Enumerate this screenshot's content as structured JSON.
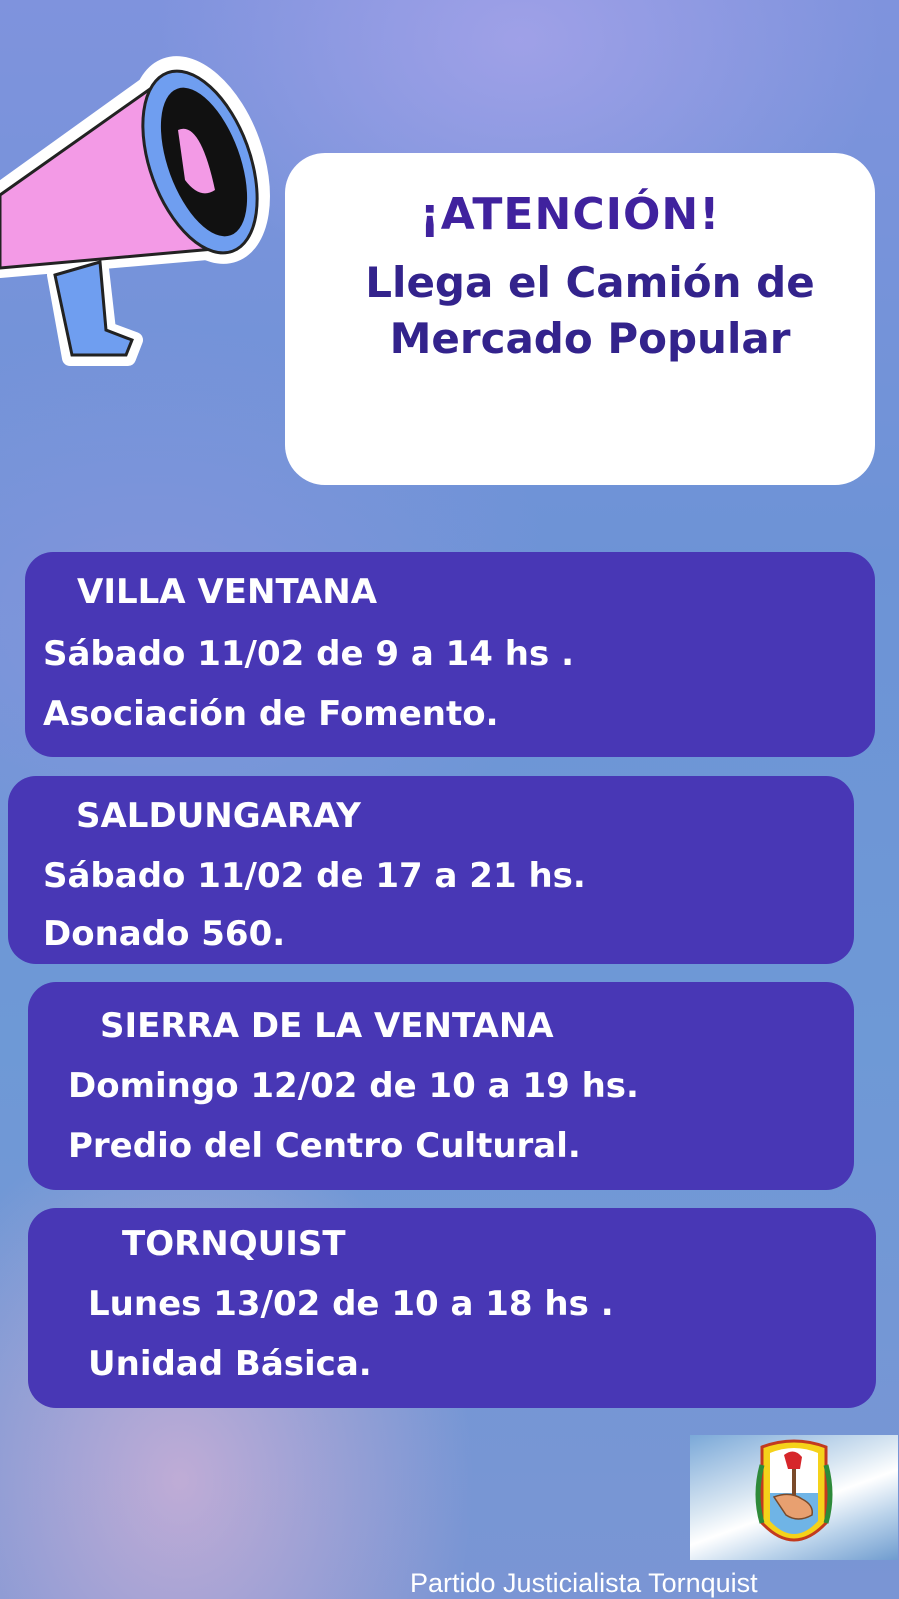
{
  "header": {
    "attention": "¡ATENCIÓN!",
    "subtitle_line1": "Llega el Camión de",
    "subtitle_line2": "Mercado Popular"
  },
  "events": [
    {
      "place": "VILLA VENTANA",
      "date": "Sábado 11/02 de 9 a 14 hs .",
      "location": "Asociación de  Fomento."
    },
    {
      "place": "SALDUNGARAY",
      "date": "Sábado 11/02 de  17 a 21 hs.",
      "location": "Donado 560."
    },
    {
      "place": "SIERRA DE LA VENTANA",
      "date": "Domingo 12/02  de  10 a 19 hs.",
      "location": "Predio del Centro Cultural."
    },
    {
      "place": "TORNQUIST",
      "date": "Lunes 13/02 de 10 a 18 hs .",
      "location": "Unidad Básica."
    }
  ],
  "footer": {
    "text": "Partido Justicialista Tornquist"
  },
  "icons": {
    "megaphone": "megaphone-icon",
    "party_logo": "party-shield-logo"
  },
  "colors": {
    "card": "#4837b5",
    "headline": "#40229e",
    "megaphone_pink": "#f39ae6",
    "megaphone_blue": "#6f9ef0"
  }
}
